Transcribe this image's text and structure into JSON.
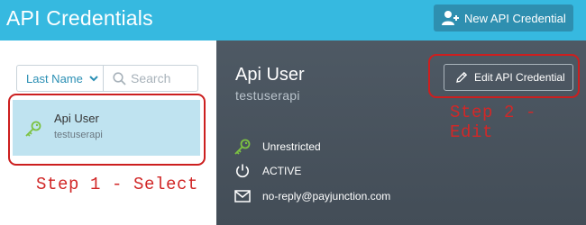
{
  "header": {
    "title": "API Credentials",
    "new_button_label": "New API Credential"
  },
  "list_controls": {
    "sort_label": "Last Name",
    "search_placeholder": "Search"
  },
  "credentials": [
    {
      "name": "Api User",
      "username": "testuserapi"
    }
  ],
  "detail": {
    "name": "Api User",
    "username": "testuserapi",
    "edit_button_label": "Edit API Credential",
    "access": "Unrestricted",
    "status": "ACTIVE",
    "email": "no-reply@payjunction.com"
  },
  "annotations": {
    "step1": "Step 1 - Select",
    "step2": "Step 2 - Edit"
  },
  "colors": {
    "header_bg": "#36b9e0",
    "accent_button": "#2e8fb0",
    "selected_row": "#bfe3f0",
    "detail_panel": "#4a555f",
    "key_icon": "#7cc242",
    "annotation_red": "#cc1f1f"
  },
  "icons": {
    "new_button": "add-user-icon",
    "sort": "chevron-down-icon",
    "search": "search-icon",
    "credential": "key-icon",
    "edit": "pencil-icon",
    "access": "key-icon",
    "status": "power-icon",
    "email": "envelope-icon"
  }
}
